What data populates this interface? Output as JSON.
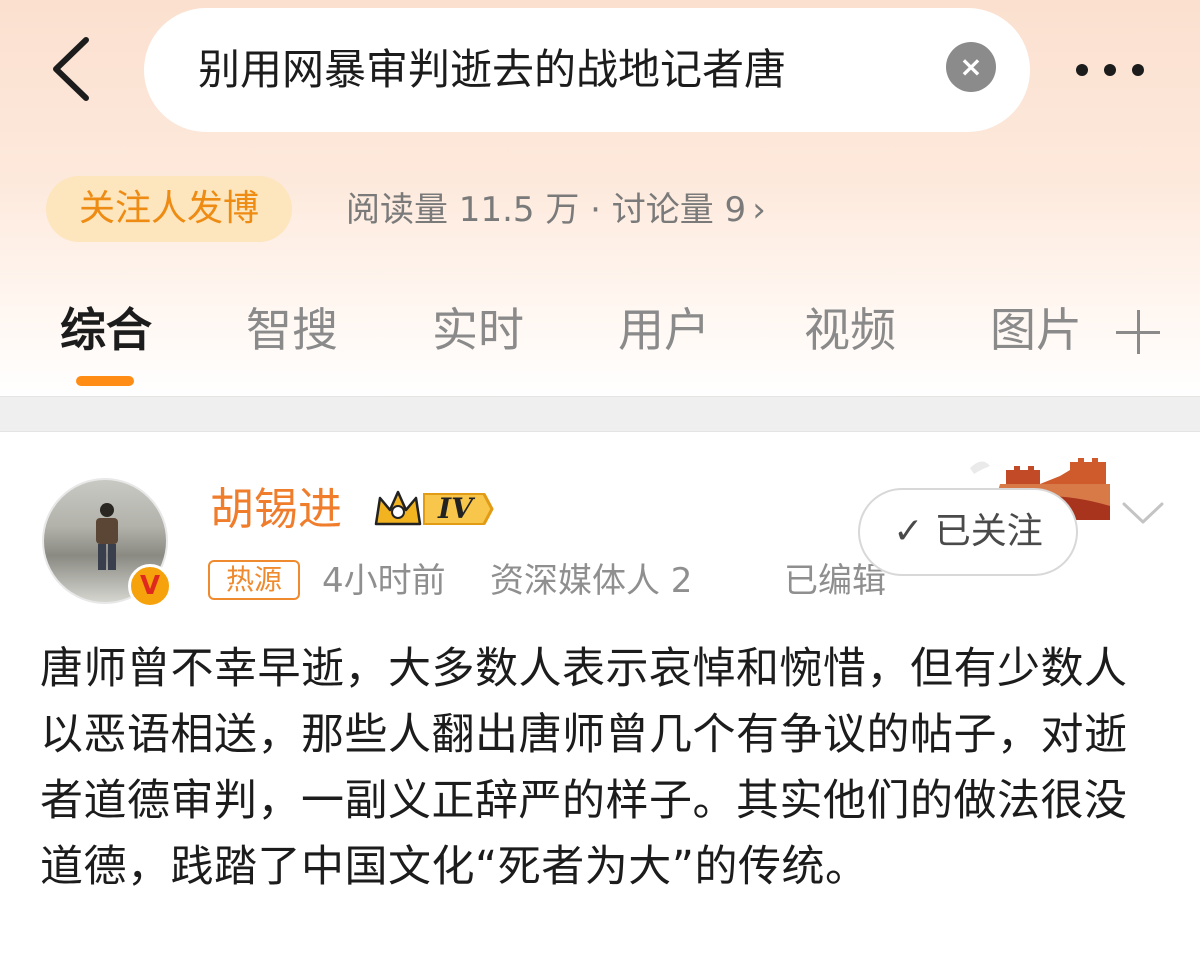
{
  "header": {
    "search_text": "别用网暴审判逝去的战地记者唐",
    "clear_icon": "×",
    "follow_pill": "关注人发博",
    "stats": "阅读量 11.5 万 · 讨论量 9",
    "stats_arrow": "›"
  },
  "tabs": [
    {
      "label": "综合"
    },
    {
      "label": "智搜"
    },
    {
      "label": "实时"
    },
    {
      "label": "用户"
    },
    {
      "label": "视频"
    },
    {
      "label": "图片"
    }
  ],
  "post": {
    "user_name": "胡锡进",
    "level_badge": "IV",
    "verified_mark": "V",
    "hot_tag": "热源",
    "time": "4小时前",
    "identity": "资深媒体人 2",
    "edited": "已编辑",
    "followed_label": "✓ 已关注",
    "content": "唐师曾不幸早逝，大多数人表示哀悼和惋惜，但有少数人以恶语相送，那些人翻出唐师曾几个有争议的帖子，对逝者道德审判，一副义正辞严的样子。其实他们的做法很没道德，践踏了中国文化“死者为大”的传统。"
  },
  "colors": {
    "accent_orange": "#ff8c14",
    "user_name": "#ef7d2c",
    "follow_pill_bg": "#fde5bd"
  }
}
